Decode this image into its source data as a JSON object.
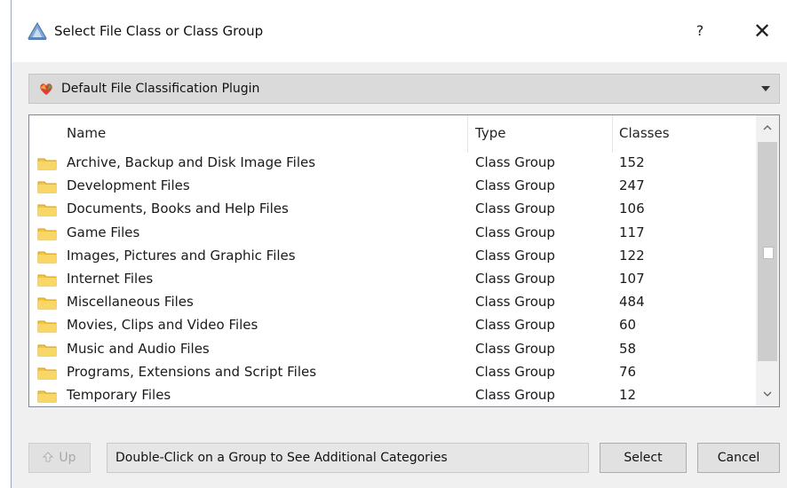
{
  "window": {
    "title": "Select File Class or Class Group",
    "help_label": "?",
    "close_label": "✕"
  },
  "plugin": {
    "selected": "Default File Classification Plugin"
  },
  "list": {
    "columns": [
      "Name",
      "Type",
      "Classes"
    ],
    "rows": [
      {
        "name": "Archive, Backup and Disk Image Files",
        "type": "Class Group",
        "classes": "152"
      },
      {
        "name": "Development Files",
        "type": "Class Group",
        "classes": "247"
      },
      {
        "name": "Documents, Books and Help Files",
        "type": "Class Group",
        "classes": "106"
      },
      {
        "name": "Game Files",
        "type": "Class Group",
        "classes": "117"
      },
      {
        "name": "Images, Pictures and Graphic Files",
        "type": "Class Group",
        "classes": "122"
      },
      {
        "name": "Internet Files",
        "type": "Class Group",
        "classes": "107"
      },
      {
        "name": "Miscellaneous Files",
        "type": "Class Group",
        "classes": "484"
      },
      {
        "name": "Movies, Clips and Video Files",
        "type": "Class Group",
        "classes": "60"
      },
      {
        "name": "Music and Audio Files",
        "type": "Class Group",
        "classes": "58"
      },
      {
        "name": "Programs, Extensions and Script Files",
        "type": "Class Group",
        "classes": "76"
      },
      {
        "name": "Temporary Files",
        "type": "Class Group",
        "classes": "12"
      }
    ]
  },
  "footer": {
    "up_label": "Up",
    "status": "Double-Click on a Group to See Additional Categories",
    "select_label": "Select",
    "cancel_label": "Cancel"
  },
  "colors": {
    "folder": "#f5c542",
    "dialog_bg": "#f0f0f0",
    "button_bg": "#e1e1e1"
  }
}
